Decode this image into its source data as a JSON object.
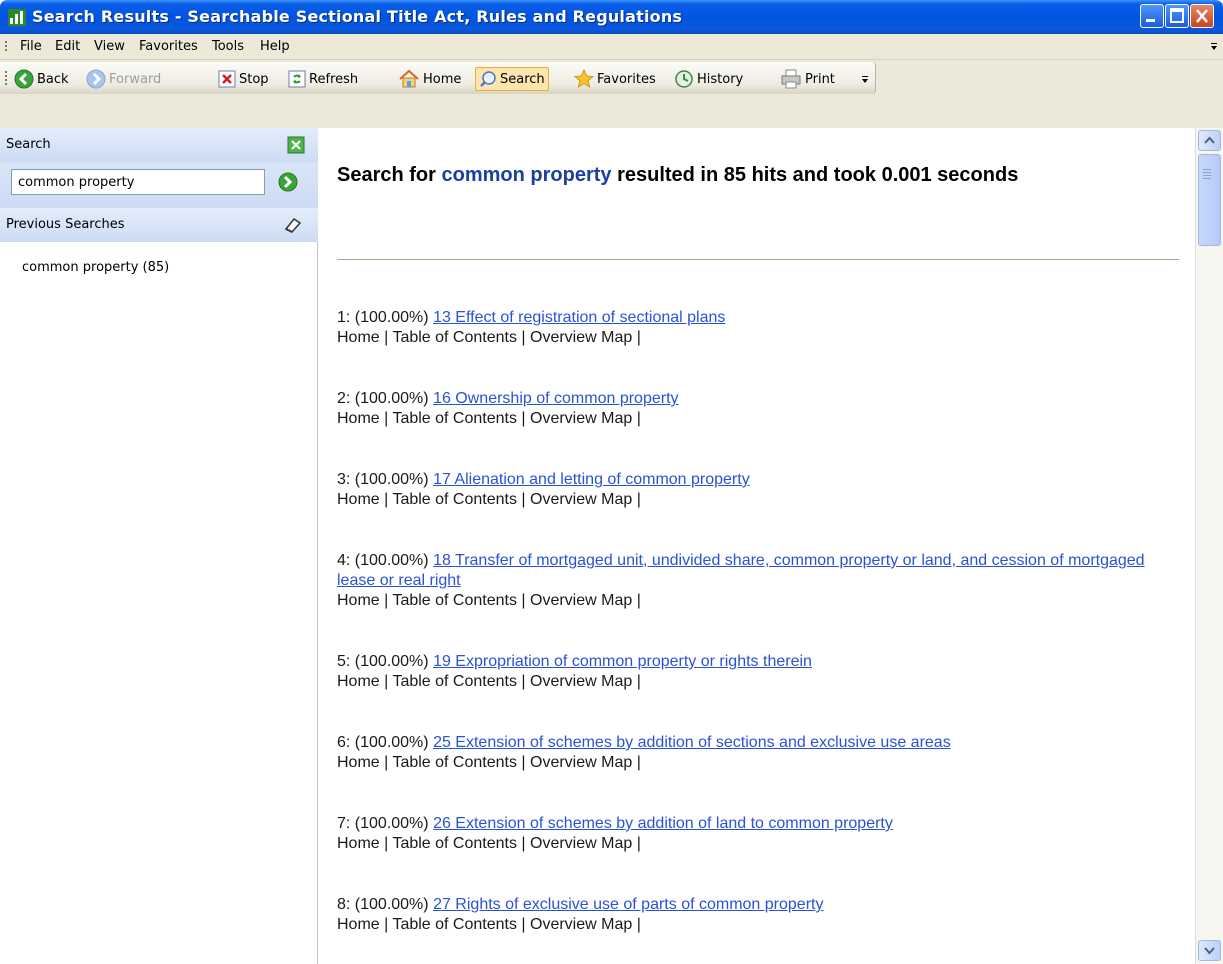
{
  "window": {
    "title": "Search Results - Searchable Sectional Title Act, Rules and Regulations"
  },
  "menu": {
    "items": [
      "File",
      "Edit",
      "View",
      "Favorites",
      "Tools",
      "Help"
    ]
  },
  "toolbar": {
    "back": "Back",
    "forward": "Forward",
    "stop": "Stop",
    "refresh": "Refresh",
    "home": "Home",
    "search": "Search",
    "favorites": "Favorites",
    "history": "History",
    "print": "Print"
  },
  "sidebar": {
    "search_title": "Search",
    "search_value": "common property",
    "previous_title": "Previous Searches",
    "previous_items": [
      "common property (85)"
    ]
  },
  "results": {
    "heading_prefix": "Search for ",
    "heading_term": "common property",
    "heading_suffix": " resulted in 85 hits and took 0.001 seconds",
    "nav_text": "Home | Table of Contents | Overview Map |",
    "items": [
      {
        "prefix": "1: (100.00%) ",
        "link": "13 Effect of registration of sectional plans"
      },
      {
        "prefix": "2: (100.00%) ",
        "link": "16 Ownership of common property"
      },
      {
        "prefix": "3: (100.00%) ",
        "link": "17 Alienation and letting of common property"
      },
      {
        "prefix": "4: (100.00%) ",
        "link": "18 Transfer of mortgaged unit, undivided share, common property or land, and cession of mortgaged lease or real right"
      },
      {
        "prefix": "5: (100.00%) ",
        "link": "19 Expropriation of common property or rights therein"
      },
      {
        "prefix": "6: (100.00%) ",
        "link": "25 Extension of schemes by addition of sections and exclusive use areas"
      },
      {
        "prefix": "7: (100.00%) ",
        "link": "26 Extension of schemes by addition of land to common property"
      },
      {
        "prefix": "8: (100.00%) ",
        "link": "27 Rights of exclusive use of parts of common property"
      }
    ]
  },
  "colors": {
    "titlebar": "#0054e3",
    "link": "#2a52d8",
    "heading_term": "#1a3fa3",
    "panel_bg": "#cddcf4"
  }
}
